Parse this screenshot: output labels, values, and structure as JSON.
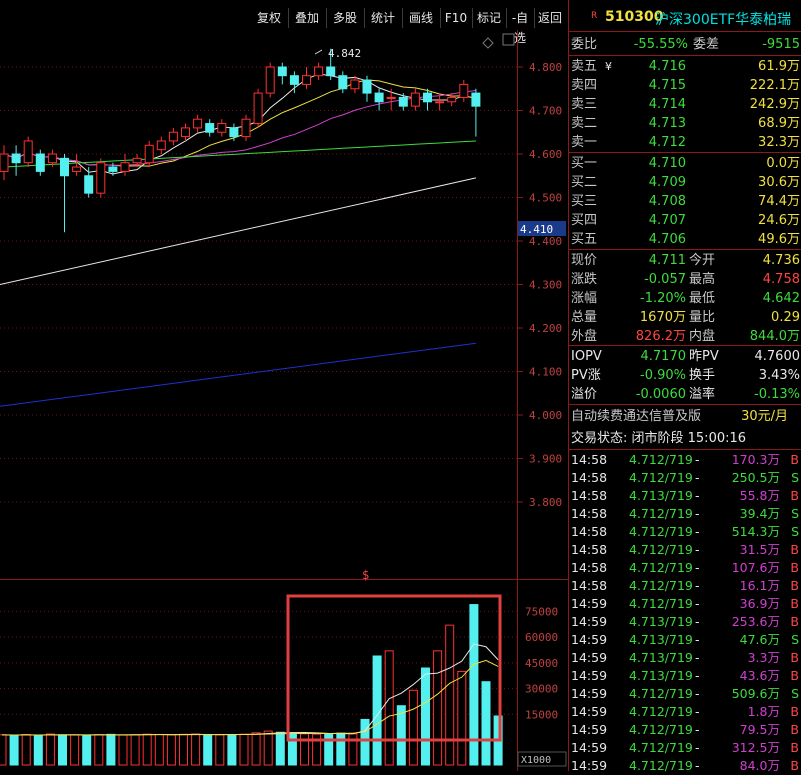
{
  "toolbar": {
    "buttons": [
      "复权",
      "叠加",
      "多股",
      "统计",
      "画线",
      "F10",
      "标记",
      "-自选",
      "返回"
    ]
  },
  "chart": {
    "price_labels": [
      "4.800",
      "4.700",
      "4.600",
      "4.500",
      "4.400",
      "4.300",
      "4.200",
      "4.100",
      "4.000",
      "3.900",
      "3.800"
    ],
    "current_price_tag": "4.410",
    "high_marker": "4.842",
    "volume_labels": [
      "75000",
      "60000",
      "45000",
      "30000",
      "15000"
    ],
    "volume_unit": "X1000",
    "divider_marker": "$"
  },
  "chart_data": {
    "type": "candlestick",
    "price_axis": [
      3.75,
      4.85
    ],
    "volume_axis": [
      0,
      85000
    ],
    "candles": [
      {
        "o": 4.56,
        "c": 4.6,
        "h": 4.62,
        "l": 4.54
      },
      {
        "o": 4.6,
        "c": 4.58,
        "h": 4.62,
        "l": 4.55
      },
      {
        "o": 4.58,
        "c": 4.63,
        "h": 4.64,
        "l": 4.57
      },
      {
        "o": 4.6,
        "c": 4.56,
        "h": 4.61,
        "l": 4.55
      },
      {
        "o": 4.58,
        "c": 4.6,
        "h": 4.61,
        "l": 4.57
      },
      {
        "o": 4.59,
        "c": 4.55,
        "h": 4.6,
        "l": 4.42
      },
      {
        "o": 4.56,
        "c": 4.57,
        "h": 4.6,
        "l": 4.55
      },
      {
        "o": 4.55,
        "c": 4.51,
        "h": 4.57,
        "l": 4.5
      },
      {
        "o": 4.51,
        "c": 4.58,
        "h": 4.59,
        "l": 4.5
      },
      {
        "o": 4.57,
        "c": 4.56,
        "h": 4.58,
        "l": 4.55
      },
      {
        "o": 4.56,
        "c": 4.58,
        "h": 4.6,
        "l": 4.55
      },
      {
        "o": 4.58,
        "c": 4.59,
        "h": 4.6,
        "l": 4.57
      },
      {
        "o": 4.58,
        "c": 4.62,
        "h": 4.63,
        "l": 4.57
      },
      {
        "o": 4.61,
        "c": 4.63,
        "h": 4.64,
        "l": 4.6
      },
      {
        "o": 4.63,
        "c": 4.65,
        "h": 4.66,
        "l": 4.62
      },
      {
        "o": 4.64,
        "c": 4.66,
        "h": 4.67,
        "l": 4.63
      },
      {
        "o": 4.66,
        "c": 4.68,
        "h": 4.69,
        "l": 4.65
      },
      {
        "o": 4.67,
        "c": 4.65,
        "h": 4.68,
        "l": 4.64
      },
      {
        "o": 4.65,
        "c": 4.67,
        "h": 4.68,
        "l": 4.64
      },
      {
        "o": 4.66,
        "c": 4.64,
        "h": 4.67,
        "l": 4.63
      },
      {
        "o": 4.64,
        "c": 4.68,
        "h": 4.69,
        "l": 4.63
      },
      {
        "o": 4.67,
        "c": 4.74,
        "h": 4.75,
        "l": 4.66
      },
      {
        "o": 4.74,
        "c": 4.8,
        "h": 4.81,
        "l": 4.73
      },
      {
        "o": 4.8,
        "c": 4.78,
        "h": 4.81,
        "l": 4.76
      },
      {
        "o": 4.78,
        "c": 4.76,
        "h": 4.79,
        "l": 4.74
      },
      {
        "o": 4.76,
        "c": 4.78,
        "h": 4.8,
        "l": 4.75
      },
      {
        "o": 4.78,
        "c": 4.8,
        "h": 4.81,
        "l": 4.77
      },
      {
        "o": 4.8,
        "c": 4.78,
        "h": 4.842,
        "l": 4.77
      },
      {
        "o": 4.78,
        "c": 4.75,
        "h": 4.79,
        "l": 4.74
      },
      {
        "o": 4.75,
        "c": 4.77,
        "h": 4.78,
        "l": 4.74
      },
      {
        "o": 4.77,
        "c": 4.74,
        "h": 4.78,
        "l": 4.72
      },
      {
        "o": 4.74,
        "c": 4.72,
        "h": 4.75,
        "l": 4.7
      },
      {
        "o": 4.73,
        "c": 4.73,
        "h": 4.75,
        "l": 4.7
      },
      {
        "o": 4.73,
        "c": 4.71,
        "h": 4.74,
        "l": 4.7
      },
      {
        "o": 4.71,
        "c": 4.74,
        "h": 4.75,
        "l": 4.7
      },
      {
        "o": 4.74,
        "c": 4.72,
        "h": 4.75,
        "l": 4.7
      },
      {
        "o": 4.72,
        "c": 4.72,
        "h": 4.74,
        "l": 4.7
      },
      {
        "o": 4.72,
        "c": 4.73,
        "h": 4.74,
        "l": 4.71
      },
      {
        "o": 4.73,
        "c": 4.76,
        "h": 4.77,
        "l": 4.72
      },
      {
        "o": 4.74,
        "c": 4.71,
        "h": 4.75,
        "l": 4.64
      }
    ],
    "volumes": [
      3000,
      2800,
      3200,
      2600,
      3500,
      3000,
      2900,
      2700,
      3100,
      3300,
      2900,
      3100,
      3400,
      3200,
      3000,
      3300,
      3500,
      2900,
      3000,
      3200,
      3400,
      4200,
      5200,
      4500,
      4200,
      3600,
      3400,
      3500,
      4000,
      3600,
      12000,
      49000,
      52000,
      20000,
      29000,
      42000,
      52000,
      67000,
      40000,
      79000,
      34000,
      14000
    ]
  },
  "quote": {
    "code": "510300",
    "name": "沪深300ETF华泰柏瑞",
    "r_mark": "R",
    "weibi_label": "委比",
    "weibi_value": "-55.55%",
    "weicha_label": "委差",
    "weicha_value": "-9515",
    "sells": [
      {
        "label": "卖五",
        "flag": "¥",
        "price": "4.716",
        "vol": "61.9万"
      },
      {
        "label": "卖四",
        "flag": "",
        "price": "4.715",
        "vol": "222.1万"
      },
      {
        "label": "卖三",
        "flag": "",
        "price": "4.714",
        "vol": "242.9万"
      },
      {
        "label": "卖二",
        "flag": "",
        "price": "4.713",
        "vol": "68.9万"
      },
      {
        "label": "卖一",
        "flag": "",
        "price": "4.712",
        "vol": "32.3万"
      }
    ],
    "buys": [
      {
        "label": "买一",
        "price": "4.710",
        "vol": "0.0万"
      },
      {
        "label": "买二",
        "price": "4.709",
        "vol": "30.6万"
      },
      {
        "label": "买三",
        "price": "4.708",
        "vol": "74.4万"
      },
      {
        "label": "买四",
        "price": "4.707",
        "vol": "24.6万"
      },
      {
        "label": "买五",
        "price": "4.706",
        "vol": "49.6万"
      }
    ],
    "stats": [
      {
        "l1": "现价",
        "v1": "4.711",
        "l2": "今开",
        "v2": "4.736"
      },
      {
        "l1": "涨跌",
        "v1": "-0.057",
        "l2": "最高",
        "v2": "4.758"
      },
      {
        "l1": "涨幅",
        "v1": "-1.20%",
        "l2": "最低",
        "v2": "4.642"
      },
      {
        "l1": "总量",
        "v1": "1670万",
        "l2": "量比",
        "v2": "0.29"
      },
      {
        "l1": "外盘",
        "v1": "826.2万",
        "l2": "内盘",
        "v2": "844.0万"
      }
    ],
    "iopv": [
      {
        "l1": "IOPV",
        "v1": "4.7170",
        "l2": "昨PV",
        "v2": "4.7600"
      },
      {
        "l1": "PV涨",
        "v1": "-0.90%",
        "l2": "换手",
        "v2": "3.43%"
      },
      {
        "l1": "溢价",
        "v1": "-0.0060",
        "l2": "溢率",
        "v2": "-0.13%"
      }
    ],
    "promo_text": "自动续费通达信普及版",
    "promo_price": "30元/月",
    "status_text": "交易状态: 闭市阶段 15:00:16",
    "ticks": [
      {
        "t": "14:58",
        "p": "4.712/719",
        "d": "-",
        "v": "170.3万",
        "s": "B"
      },
      {
        "t": "14:58",
        "p": "4.712/719",
        "d": "-",
        "v": "250.5万",
        "s": "S"
      },
      {
        "t": "14:58",
        "p": "4.713/719",
        "d": "-",
        "v": "55.8万",
        "s": "B"
      },
      {
        "t": "14:58",
        "p": "4.712/719",
        "d": "-",
        "v": "39.4万",
        "s": "S"
      },
      {
        "t": "14:58",
        "p": "4.712/719",
        "d": "-",
        "v": "514.3万",
        "s": "S"
      },
      {
        "t": "14:58",
        "p": "4.712/719",
        "d": "-",
        "v": "31.5万",
        "s": "B"
      },
      {
        "t": "14:58",
        "p": "4.712/719",
        "d": "-",
        "v": "107.6万",
        "s": "B"
      },
      {
        "t": "14:58",
        "p": "4.712/719",
        "d": "-",
        "v": "16.1万",
        "s": "B"
      },
      {
        "t": "14:59",
        "p": "4.712/719",
        "d": "-",
        "v": "36.9万",
        "s": "B"
      },
      {
        "t": "14:59",
        "p": "4.713/719",
        "d": "-",
        "v": "253.6万",
        "s": "B"
      },
      {
        "t": "14:59",
        "p": "4.713/719",
        "d": "-",
        "v": "47.6万",
        "s": "S"
      },
      {
        "t": "14:59",
        "p": "4.713/719",
        "d": "-",
        "v": "3.3万",
        "s": "B"
      },
      {
        "t": "14:59",
        "p": "4.713/719",
        "d": "-",
        "v": "43.6万",
        "s": "B"
      },
      {
        "t": "14:59",
        "p": "4.712/719",
        "d": "-",
        "v": "509.6万",
        "s": "S"
      },
      {
        "t": "14:59",
        "p": "4.712/719",
        "d": "-",
        "v": "1.8万",
        "s": "B"
      },
      {
        "t": "14:59",
        "p": "4.712/719",
        "d": "-",
        "v": "79.5万",
        "s": "B"
      },
      {
        "t": "14:59",
        "p": "4.712/719",
        "d": "-",
        "v": "312.5万",
        "s": "B"
      },
      {
        "t": "14:59",
        "p": "4.712/719",
        "d": "-",
        "v": "84.0万",
        "s": "B"
      }
    ]
  }
}
